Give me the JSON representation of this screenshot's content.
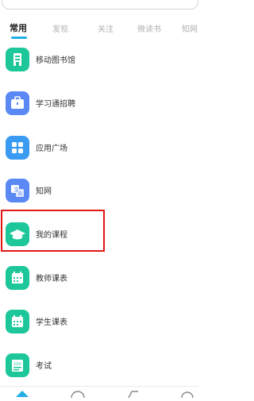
{
  "tabs": [
    {
      "label": "常用",
      "active": true
    },
    {
      "label": "发现",
      "active": false
    },
    {
      "label": "关注",
      "active": false
    },
    {
      "label": "微读书",
      "active": false
    },
    {
      "label": "知网",
      "active": false
    }
  ],
  "apps": [
    {
      "label": "移动图书馆",
      "icon": "library-icon",
      "color": "#1ec79a"
    },
    {
      "label": "学习通招聘",
      "icon": "briefcase-icon",
      "color": "#5a88f5"
    },
    {
      "label": "应用广场",
      "icon": "app-grid-icon",
      "color": "#3a9bf2"
    },
    {
      "label": "知网",
      "icon": "translate-icon",
      "color": "#5a88f5"
    },
    {
      "label": "我的课程",
      "icon": "graduation-cap-icon",
      "color": "#1ec79a"
    },
    {
      "label": "教师课表",
      "icon": "calendar-icon",
      "color": "#1ec79a"
    },
    {
      "label": "学生课表",
      "icon": "calendar-icon",
      "color": "#1ec79a"
    },
    {
      "label": "考试",
      "icon": "exam-icon",
      "color": "#1ec79a"
    }
  ],
  "colors": {
    "accent": "#22aee6",
    "highlight": "#e01515",
    "green": "#1ec79a",
    "blue": "#5a88f5"
  },
  "bottom_nav": [
    {
      "icon": "home-icon",
      "active": true
    },
    {
      "icon": "message-icon",
      "active": false
    },
    {
      "icon": "notes-icon",
      "active": false
    },
    {
      "icon": "profile-icon",
      "active": false
    }
  ]
}
